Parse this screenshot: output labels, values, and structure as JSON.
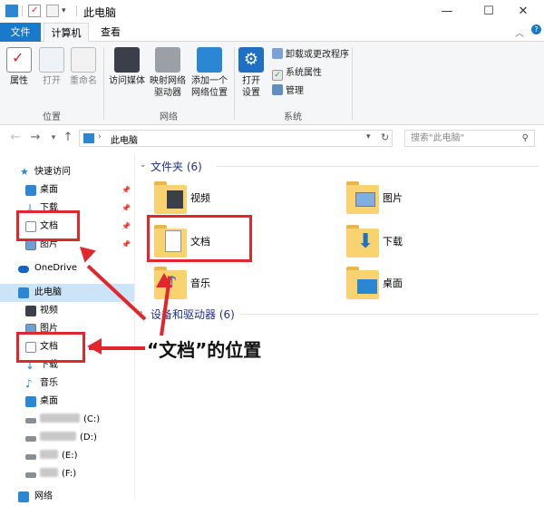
{
  "window": {
    "title": "此电脑",
    "min": "—",
    "max": "☐",
    "close": "✕"
  },
  "tabs": {
    "file": "文件",
    "computer": "计算机",
    "view": "查看"
  },
  "ribbon": {
    "properties": "属性",
    "open": "打开",
    "rename": "重命名",
    "access_media": "访问媒体",
    "map_drive_1": "映射网络",
    "map_drive_2": "驱动器",
    "add_location_1": "添加一个",
    "add_location_2": "网络位置",
    "open_settings_1": "打开",
    "open_settings_2": "设置",
    "uninstall": "卸载或更改程序",
    "sys_props": "系统属性",
    "manage": "管理",
    "group_location": "位置",
    "group_network": "网络",
    "group_system": "系统"
  },
  "nav": {
    "path": "此电脑",
    "search_placeholder": "搜索\"此电脑\""
  },
  "sidebar": {
    "quick_access": "快速访问",
    "desktop": "桌面",
    "downloads": "下载",
    "documents": "文档",
    "pictures": "图片",
    "onedrive": "OneDrive",
    "this_pc": "此电脑",
    "videos": "视频",
    "pictures2": "图片",
    "documents2": "文档",
    "downloads2": "下载",
    "music": "音乐",
    "desktop2": "桌面",
    "drive_c": "(C:)",
    "drive_d": "(D:)",
    "drive_e": "(E:)",
    "drive_f": "(F:)",
    "network": "网络"
  },
  "main": {
    "folders_header": "文件夹 (6)",
    "devices_header": "设备和驱动器 (6)",
    "folders": {
      "videos": "视频",
      "pictures": "图片",
      "documents": "文档",
      "downloads": "下载",
      "music": "音乐",
      "desktop": "桌面"
    }
  },
  "annotation": "“文档”的位置",
  "colors": {
    "accent": "#1979ca",
    "highlight": "#e2262d",
    "folder": "#f9d36f"
  }
}
